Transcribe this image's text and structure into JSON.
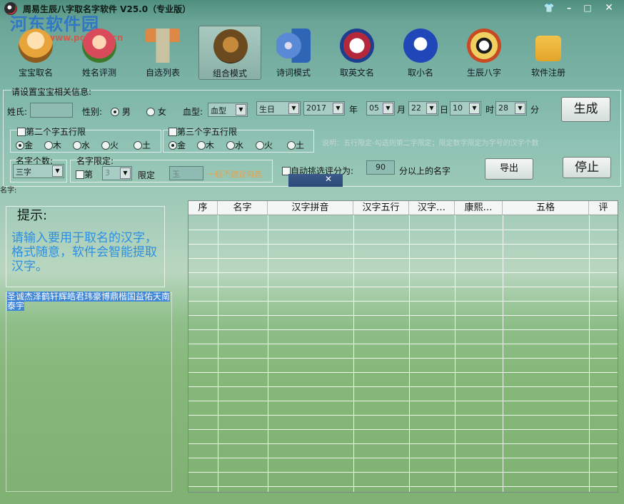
{
  "window": {
    "title": "周易生辰八字取名字软件 V25.0（专业版）",
    "controls": [
      "skin-icon",
      "minimize-icon",
      "maximize-icon",
      "close-icon"
    ]
  },
  "watermark": {
    "text": "河东软件园",
    "url": "www.pc0359.cn"
  },
  "toolbar": [
    {
      "label": "宝宝取名",
      "icon": "baby-icon",
      "color": "#e6a43a"
    },
    {
      "label": "姓名评测",
      "icon": "doll-icon",
      "color": "#d94a5a"
    },
    {
      "label": "自选列表",
      "icon": "brush-cup-icon",
      "color": "#c9c2a0"
    },
    {
      "label": "组合模式",
      "icon": "lion-icon",
      "color": "#6a4a1e"
    },
    {
      "label": "诗词模式",
      "icon": "book-cd-icon",
      "color": "#2f65b5"
    },
    {
      "label": "取英文名",
      "icon": "barcelona-badge-icon",
      "color": "#b5283a"
    },
    {
      "label": "取小名",
      "icon": "wolf-badge-icon",
      "color": "#1f47b8"
    },
    {
      "label": "生辰八字",
      "icon": "bagua-icon",
      "color": "#c84a22"
    },
    {
      "label": "软件注册",
      "icon": "padlock-icon",
      "color": "#e2a52a"
    }
  ],
  "form": {
    "group_title": "请设置宝宝相关信息:",
    "surname_label": "姓氏:",
    "surname_value": "",
    "gender_label": "性别:",
    "gender_options": [
      "男",
      "女"
    ],
    "gender_selected": "男",
    "blood_label": "血型:",
    "blood_value": "血型",
    "birthday_value": "生日",
    "year_value": "2017",
    "year_label": "年",
    "month_value": "05",
    "month_label": "月",
    "day_value": "22",
    "day_label": "日",
    "hour_value": "10",
    "hour_label": "时",
    "minute_value": "28",
    "minute_label": "分",
    "generate_label": "生成",
    "second_char": {
      "title": "第二个字五行限",
      "options": [
        "金",
        "木",
        "水",
        "火",
        "土"
      ],
      "selected": "金"
    },
    "third_char": {
      "title": "第三个字五行限",
      "options": [
        "金",
        "木",
        "水",
        "火",
        "土"
      ],
      "selected": "金"
    },
    "note": "说明：五行限定-勾选则第二字限定；限定数字限定为字号的汉字个数",
    "name_count_title": "名字个数:",
    "name_count_value": "三字",
    "name_limit_title": "名字限定:",
    "limit_prefix": "第",
    "limit_position": "3",
    "limit_label": "限定",
    "limit_char": "玉",
    "limit_hint": "一般不建议勾选",
    "auto_pick_label": "自动挑选评分为:",
    "auto_pick_score": "90",
    "auto_pick_suffix": "分以上的名字",
    "export_label": "导出",
    "stop_label": "停止",
    "partial_label": "名字:"
  },
  "tips": {
    "title": "提示:",
    "text": "请输入要用于取名的汉字，格式随意，软件会智能提取汉字。",
    "chars_line1": "圣诚杰泽鹤轩辉皓君玮豪博鼎楷国益佑天南",
    "chars_line2": "泰宇"
  },
  "table": {
    "columns": [
      "序",
      "名字",
      "汉字拼音",
      "汉字五行",
      "汉字…",
      "康熙…",
      "五格",
      "评"
    ],
    "rows": []
  }
}
